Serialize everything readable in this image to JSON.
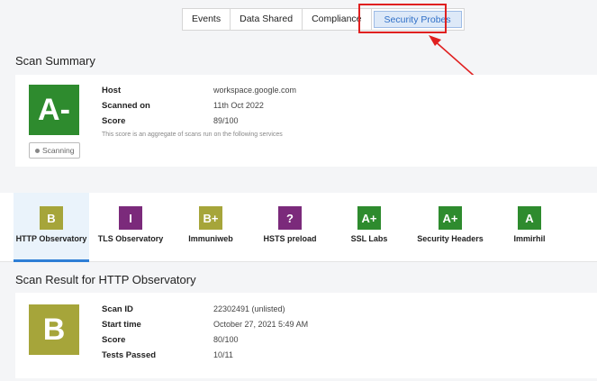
{
  "tabs": [
    {
      "label": "Events"
    },
    {
      "label": "Data Shared"
    },
    {
      "label": "Compliance"
    },
    {
      "label": "Security Probes"
    }
  ],
  "summary": {
    "title": "Scan Summary",
    "grade": "A-",
    "grade_color": "#2e8b2e",
    "scanning_label": "Scanning",
    "host_label": "Host",
    "host": "workspace.google.com",
    "scanned_label": "Scanned on",
    "scanned": "11th Oct 2022",
    "score_label": "Score",
    "score": "89/100",
    "note": "This score is an aggregate of scans run on the following services"
  },
  "probes": [
    {
      "grade": "B",
      "name": "HTTP Observatory",
      "color": "#a6a53a"
    },
    {
      "grade": "I",
      "name": "TLS Observatory",
      "color": "#7b2a7b"
    },
    {
      "grade": "B+",
      "name": "Immuniweb",
      "color": "#a6a53a"
    },
    {
      "grade": "?",
      "name": "HSTS preload",
      "color": "#7b2a7b"
    },
    {
      "grade": "A+",
      "name": "SSL Labs",
      "color": "#2e8b2e"
    },
    {
      "grade": "A+",
      "name": "Security Headers",
      "color": "#2e8b2e"
    },
    {
      "grade": "A",
      "name": "Immirhil",
      "color": "#2e8b2e"
    }
  ],
  "result": {
    "title": "Scan Result for HTTP Observatory",
    "grade": "B",
    "grade_color": "#a6a53a",
    "scan_id_label": "Scan ID",
    "scan_id": "22302491 (unlisted)",
    "start_label": "Start time",
    "start": "October 27, 2021 5:49 AM",
    "score_label": "Score",
    "score": "80/100",
    "tests_label": "Tests Passed",
    "tests": "10/11"
  }
}
